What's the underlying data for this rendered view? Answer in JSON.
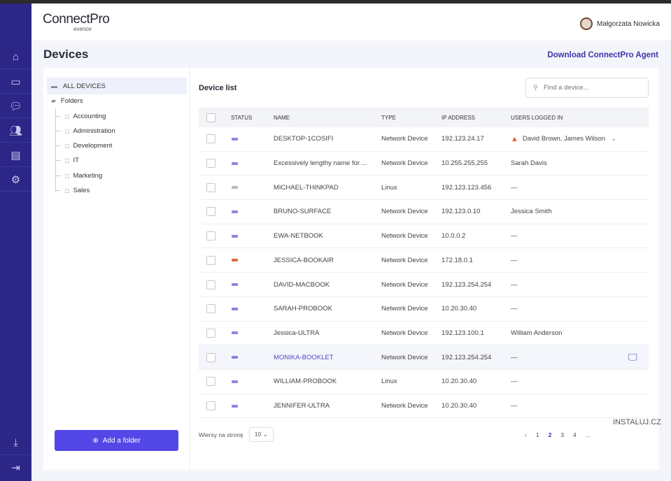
{
  "app": {
    "logo": "ConnectPro",
    "logo_sub": "exence"
  },
  "user": {
    "name": "Małgorzata Nowicka"
  },
  "page": {
    "title": "Devices",
    "download": "Download ConnectPro Agent"
  },
  "sidebar": {
    "icons": [
      "home-icon",
      "devices-icon",
      "chat-icon",
      "users-icon",
      "clipboard-icon",
      "settings-icon",
      "download-icon",
      "logout-icon"
    ]
  },
  "tree": {
    "all": "ALL DEVICES",
    "folders": "Folders",
    "items": [
      "Accounting",
      "Administration",
      "Development",
      "IT",
      "Marketing",
      "Sales"
    ],
    "add": "Add a folder"
  },
  "list": {
    "title": "Device list",
    "search_placeholder": "Find a device...",
    "columns": [
      "STATUS",
      "NAME",
      "TYPE",
      "IP ADDRESS",
      "USERS LOGGED IN"
    ],
    "rows": [
      {
        "name": "DESKTOP-1COSIFI",
        "type": "Network Device",
        "ip": "192.123.24.17",
        "users": "David Brown, James Wilson",
        "status": "online"
      },
      {
        "name": "Excessively lengthy name for ...",
        "type": "Network Device",
        "ip": "10.255.255.255",
        "users": "Sarah Davis",
        "status": "online"
      },
      {
        "name": "MICHAEL-THINKPAD",
        "type": "Linux",
        "ip": "192.123.123.456",
        "users": "—",
        "status": "offline"
      },
      {
        "name": "BRUNO-SURFACE",
        "type": "Network Device",
        "ip": "192.123.0.10",
        "users": "Jessica Smith",
        "status": "online"
      },
      {
        "name": "EWA-NETBOOK",
        "type": "Network Device",
        "ip": "10.0.0.2",
        "users": "—",
        "status": "online"
      },
      {
        "name": "JESSICA-BOOKAIR",
        "type": "Network Device",
        "ip": "172.18.0.1",
        "users": "—",
        "status": "error"
      },
      {
        "name": "DAVID-MACBOOK",
        "type": "Network Device",
        "ip": "192.123.254.254",
        "users": "—",
        "status": "online"
      },
      {
        "name": "SARAH-PROBOOK",
        "type": "Network Device",
        "ip": "10.20.30.40",
        "users": "—",
        "status": "online"
      },
      {
        "name": "Jessica-ULTRA",
        "type": "Network Device",
        "ip": "192.123.100.1",
        "users": "William Anderson",
        "status": "online"
      },
      {
        "name": "MONIKA-BOOKLET",
        "type": "Network Device",
        "ip": "192.123.254.254",
        "users": "—",
        "status": "online"
      },
      {
        "name": "WILLIAM-PROBOOK",
        "type": "Linux",
        "ip": "10.20.30.40",
        "users": "—",
        "status": "online"
      },
      {
        "name": "JENNIFER-ULTRA",
        "type": "Network Device",
        "ip": "10.20.30.40",
        "users": "—",
        "status": "online"
      }
    ]
  },
  "pagination": {
    "rows_label": "Wiersy na stronę",
    "rows_value": "10",
    "prev": "‹",
    "pages": [
      "1",
      "2",
      "3",
      "4",
      "..."
    ],
    "current": "2"
  },
  "watermark": "INSTALUJ.CZ"
}
